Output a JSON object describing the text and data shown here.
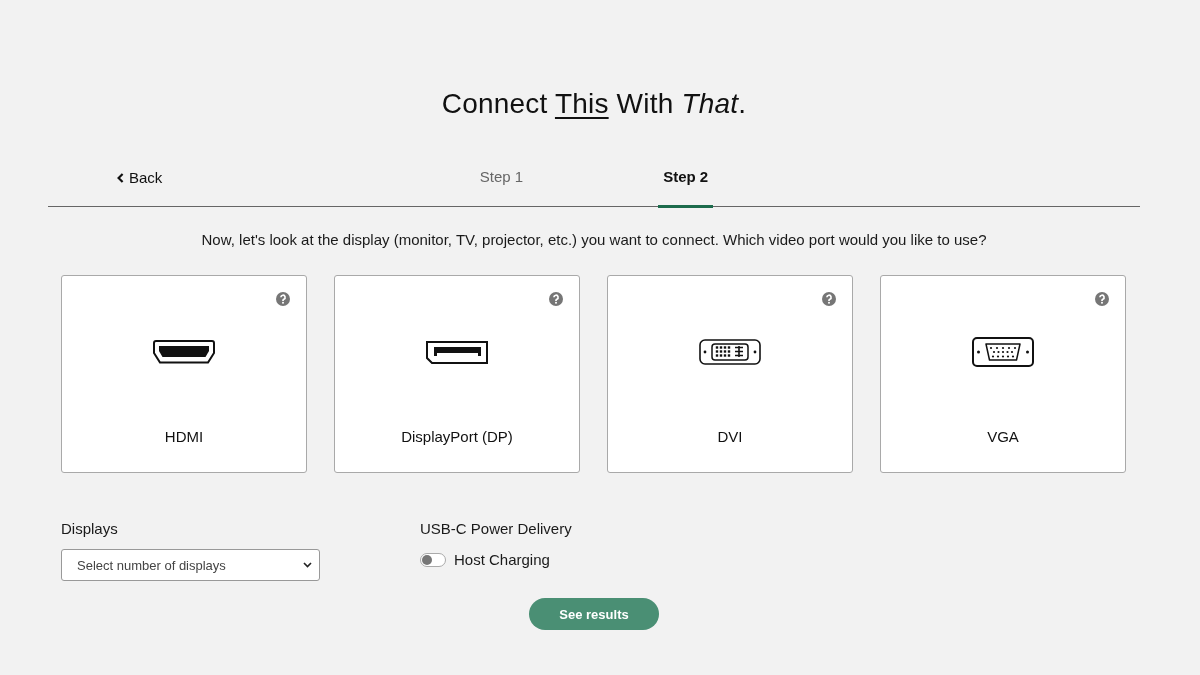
{
  "title": {
    "parts": [
      {
        "text": "Connect ",
        "kind": "plain"
      },
      {
        "text": "This",
        "kind": "underline"
      },
      {
        "text": " With ",
        "kind": "plain"
      },
      {
        "text": "That",
        "kind": "italic"
      },
      {
        "text": ".",
        "kind": "plain"
      }
    ]
  },
  "nav": {
    "back": {
      "label": "Back"
    },
    "steps": [
      {
        "label": "Step 1",
        "selected": false
      },
      {
        "label": "Step 2",
        "selected": true
      }
    ]
  },
  "prompt": "Now, let's look at the display (monitor, TV, projector, etc.) you want to connect. Which video port would you like to use?",
  "ports": [
    {
      "kind": "hdmi",
      "label": "HDMI",
      "selected": false
    },
    {
      "kind": "displayport",
      "label": "DisplayPort (DP)",
      "selected": false
    },
    {
      "kind": "dvi",
      "label": "DVI",
      "selected": false
    },
    {
      "kind": "vga",
      "label": "VGA",
      "selected": false
    }
  ],
  "displays": {
    "label": "Displays",
    "placeholder": "Select number of displays"
  },
  "power_delivery": {
    "label": "USB-C Power Delivery",
    "host_charging": {
      "label": "Host Charging",
      "on": false
    }
  },
  "submit": {
    "label": "See results"
  }
}
